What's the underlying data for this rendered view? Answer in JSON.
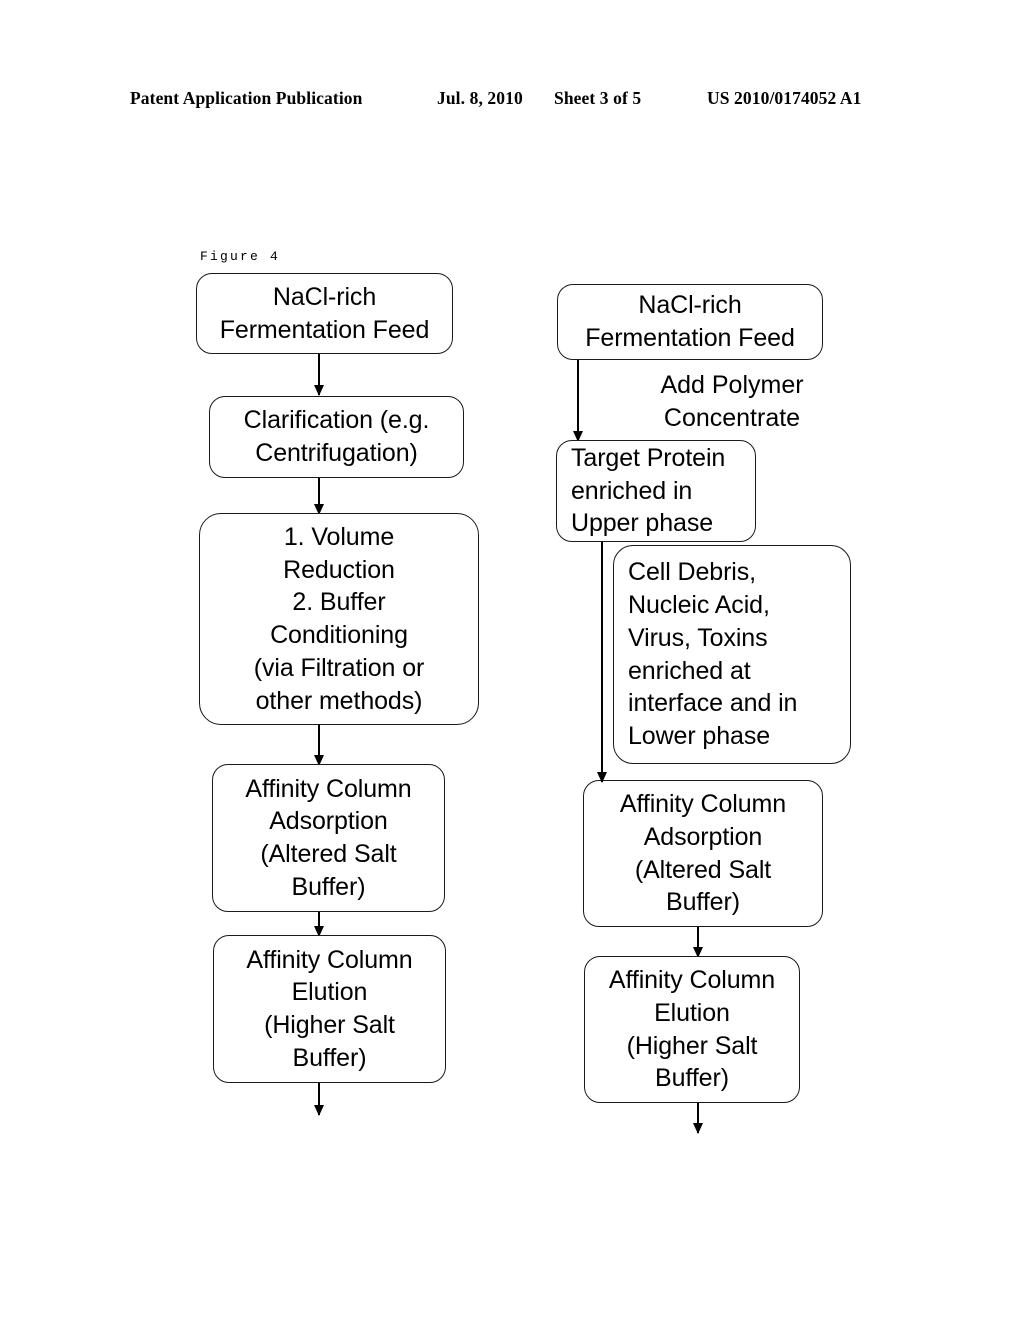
{
  "header": {
    "publication": "Patent Application Publication",
    "date": "Jul. 8, 2010",
    "sheet": "Sheet 3 of 5",
    "number": "US 2010/0174052 A1"
  },
  "figure": {
    "label": "Figure 4"
  },
  "diagram": {
    "left_column": {
      "nodes": [
        {
          "id": "left-feed",
          "text": "NaCl-rich\nFermentation Feed"
        },
        {
          "id": "left-clarification",
          "text": "Clarification (e.g.\nCentrifugation)"
        },
        {
          "id": "left-volume-buffer",
          "text": "1. Volume\nReduction\n2. Buffer\nConditioning\n(via Filtration or\nother methods)"
        },
        {
          "id": "left-adsorption",
          "text": "Affinity Column\nAdsorption\n(Altered Salt\nBuffer)"
        },
        {
          "id": "left-elution",
          "text": "Affinity Column\nElution\n(Higher Salt\nBuffer)"
        }
      ]
    },
    "right_column": {
      "nodes": [
        {
          "id": "right-feed",
          "text": "NaCl-rich\nFermentation Feed"
        },
        {
          "id": "right-annotation",
          "text": "Add Polymer\nConcentrate"
        },
        {
          "id": "right-target",
          "text": "Target Protein\nenriched  in\nUpper phase"
        },
        {
          "id": "right-debris",
          "text": "Cell Debris,\nNucleic Acid,\nVirus, Toxins\nenriched at\ninterface and in\nLower phase"
        },
        {
          "id": "right-adsorption",
          "text": "Affinity Column\nAdsorption\n(Altered Salt\nBuffer)"
        },
        {
          "id": "right-elution",
          "text": "Affinity Column\nElution\n(Higher Salt\nBuffer)"
        }
      ]
    }
  },
  "colors": {
    "ink": "#000000",
    "paper": "#ffffff",
    "stroke": "#1a1a1a"
  }
}
